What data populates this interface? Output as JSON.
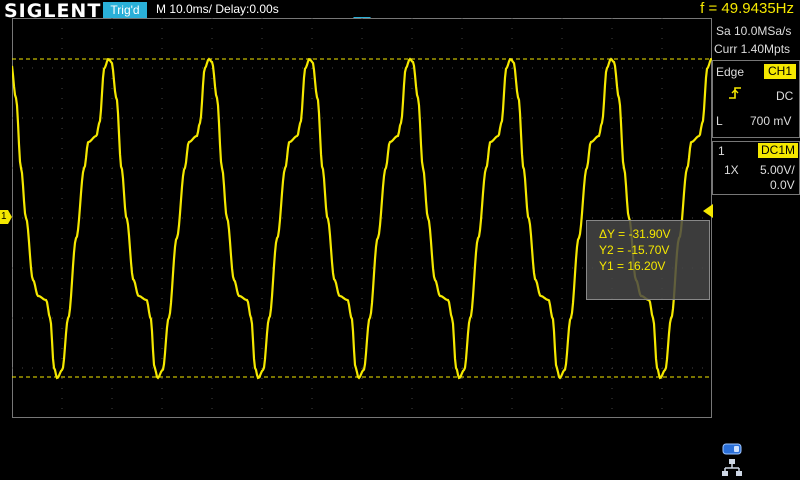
{
  "header": {
    "brand": "SIGLENT",
    "trigger_status": "Trig'd",
    "timebase": "M 10.0ms/ Delay:0.00s",
    "frequency": "f = 49.9435Hz"
  },
  "acquisition": {
    "sample_rate": "Sa 10.0MSa/s",
    "memory_depth": "Curr 1.40Mpts"
  },
  "trigger": {
    "type": "Edge",
    "source": "CH1",
    "coupling": "DC",
    "level_label": "L",
    "level_value": "700 mV"
  },
  "channel1": {
    "number": "1",
    "coupling": "DC1M",
    "probe": "1X",
    "scale": "5.00V/",
    "offset": "0.0V",
    "marker_label": "1"
  },
  "measurement": {
    "delta_y": "ΔY = -31.90V",
    "y2": "Y2 = -15.70V",
    "y1": "Y1 = 16.20V"
  },
  "colors": {
    "trace": "#f5e800",
    "trigger_status_bg": "#2ab0d8",
    "grid": "#555555"
  },
  "icons": [
    "trigger-position-icon",
    "rising-edge-icon",
    "trigger-level-icon",
    "usb-icon",
    "network-icon"
  ]
}
